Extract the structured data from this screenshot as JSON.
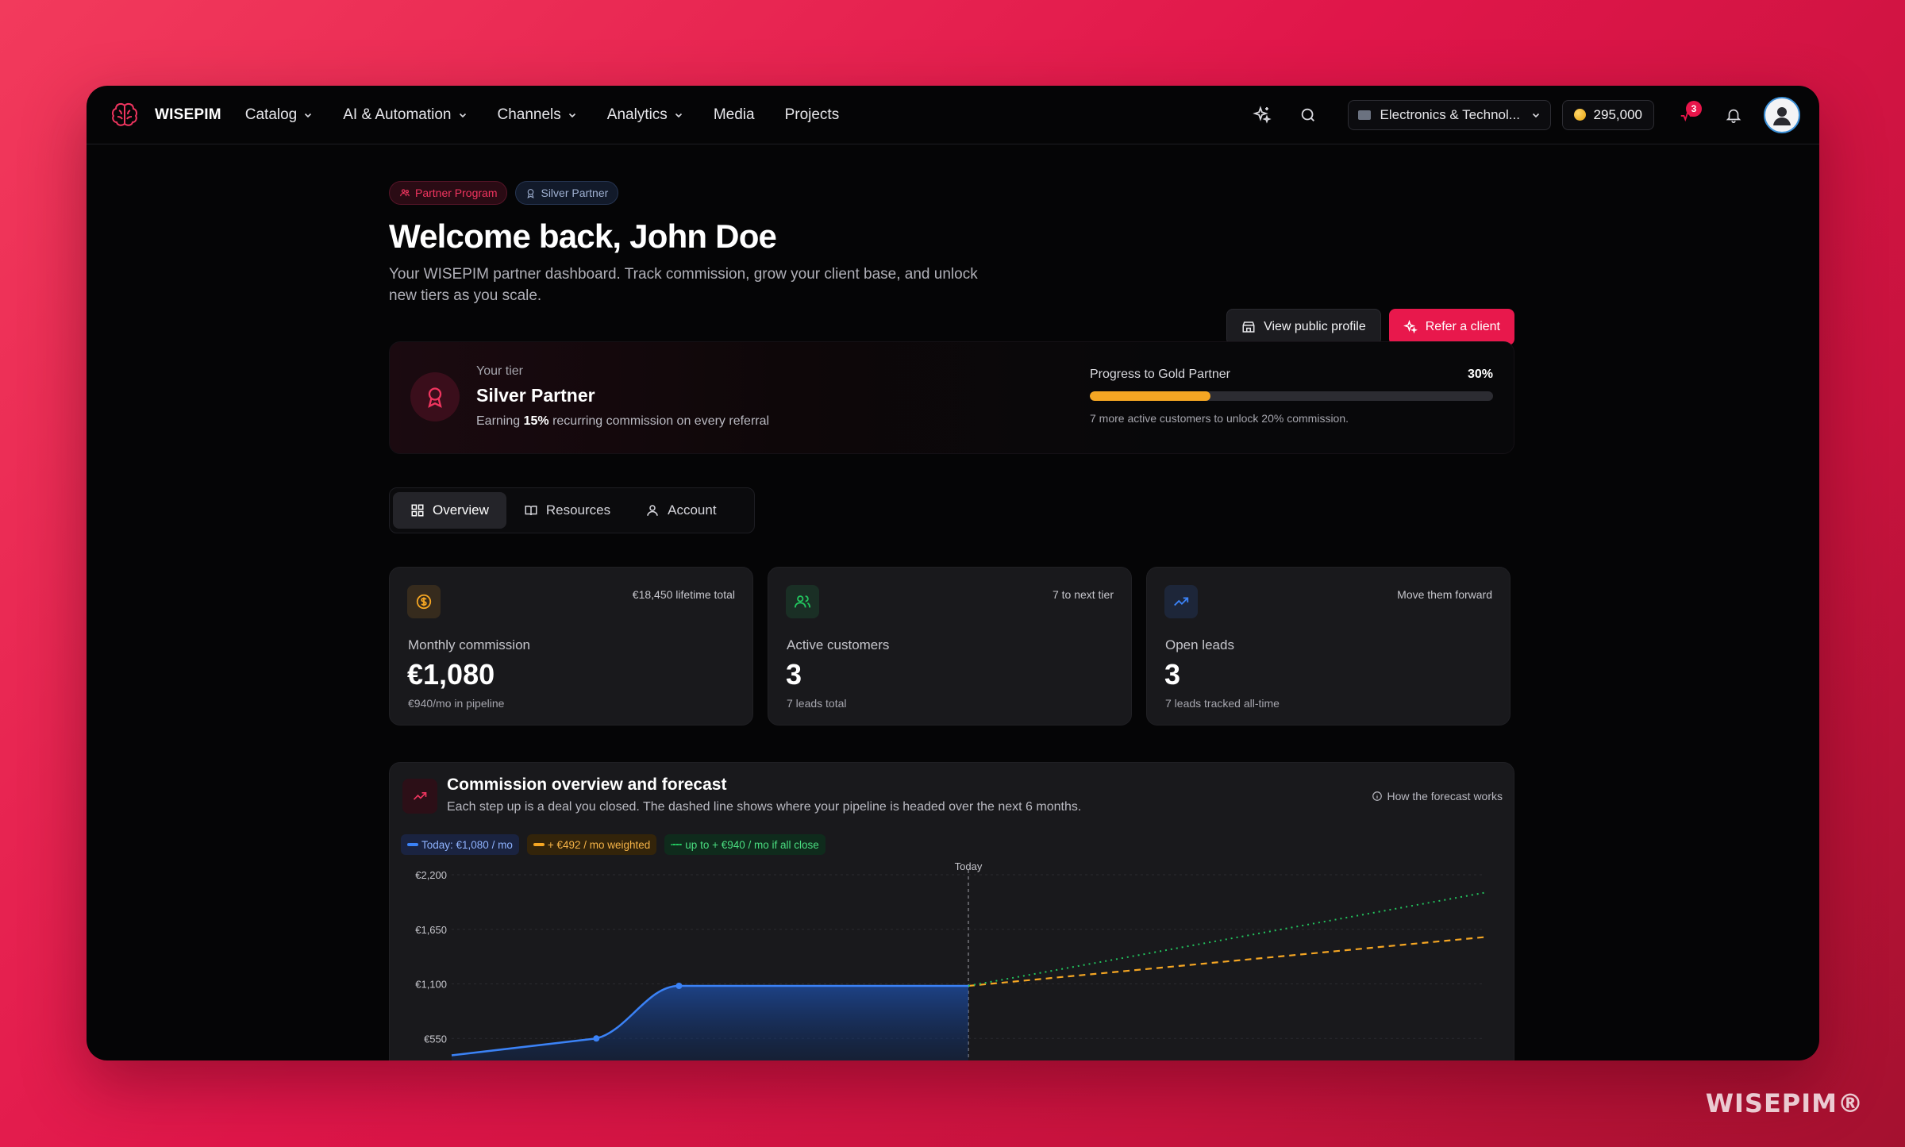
{
  "brand": {
    "name": "WISEPIM",
    "watermark": "WISEPIM®"
  },
  "nav": {
    "items": [
      {
        "label": "Catalog",
        "dropdown": true
      },
      {
        "label": "AI & Automation",
        "dropdown": true
      },
      {
        "label": "Channels",
        "dropdown": true
      },
      {
        "label": "Analytics",
        "dropdown": true
      },
      {
        "label": "Media",
        "dropdown": false
      },
      {
        "label": "Projects",
        "dropdown": false
      }
    ],
    "workspace": "Electronics & Technol...",
    "credits": "295,000",
    "alerts_count": "3"
  },
  "hero": {
    "chip_program": "Partner Program",
    "chip_tier": "Silver Partner",
    "title": "Welcome back, John Doe",
    "subtitle": "Your WISEPIM partner dashboard. Track commission, grow your client base, and unlock new tiers as you scale.",
    "view_profile": "View public profile",
    "refer": "Refer a client"
  },
  "tier": {
    "label": "Your tier",
    "name": "Silver Partner",
    "desc_prefix": "Earning ",
    "desc_rate": "15%",
    "desc_suffix": " recurring commission on every referral",
    "progress_label": "Progress to Gold Partner",
    "progress_pct": "30%",
    "progress_value": 0.3,
    "progress_note": "7 more active customers to unlock 20% commission."
  },
  "tabs": [
    {
      "label": "Overview",
      "active": true
    },
    {
      "label": "Resources",
      "active": false
    },
    {
      "label": "Account",
      "active": false
    }
  ],
  "stats": [
    {
      "icon": "dollar-icon",
      "meta": "€18,450 lifetime total",
      "label": "Monthly commission",
      "value": "€1,080",
      "sub": "€940/mo in pipeline",
      "color": "#f5a623"
    },
    {
      "icon": "users-icon",
      "meta": "7 to next tier",
      "label": "Active customers",
      "value": "3",
      "sub": "7 leads total",
      "color": "#22c55e"
    },
    {
      "icon": "trend-icon",
      "meta": "Move them forward",
      "label": "Open leads",
      "value": "3",
      "sub": "7 leads tracked all-time",
      "color": "#3b82f6"
    }
  ],
  "forecast": {
    "title": "Commission overview and forecast",
    "subtitle": "Each step up is a deal you closed. The dashed line shows where your pipeline is headed over the next 6 months.",
    "help": "How the forecast works",
    "legend_today": "Today: €1,080 / mo",
    "legend_weighted": "+ €492 / mo weighted",
    "legend_all": "up to + €940 / mo if all close"
  },
  "chart_data": {
    "type": "line",
    "y_ticks": [
      "€2,200",
      "€1,650",
      "€1,100",
      "€550"
    ],
    "ylim": [
      0,
      2200
    ],
    "today_label": "Today",
    "colors": {
      "history": "#3b82f6",
      "weighted": "#f5a623",
      "all_close": "#22c55e"
    },
    "series": [
      {
        "x": [
          0,
          0.14,
          0.22,
          0.5
        ],
        "values": [
          380,
          550,
          1080,
          1080
        ]
      },
      {
        "x": [
          0.5,
          1
        ],
        "values": [
          1080,
          1572
        ]
      },
      {
        "x": [
          0.5,
          1
        ],
        "values": [
          1080,
          2020
        ]
      }
    ]
  }
}
